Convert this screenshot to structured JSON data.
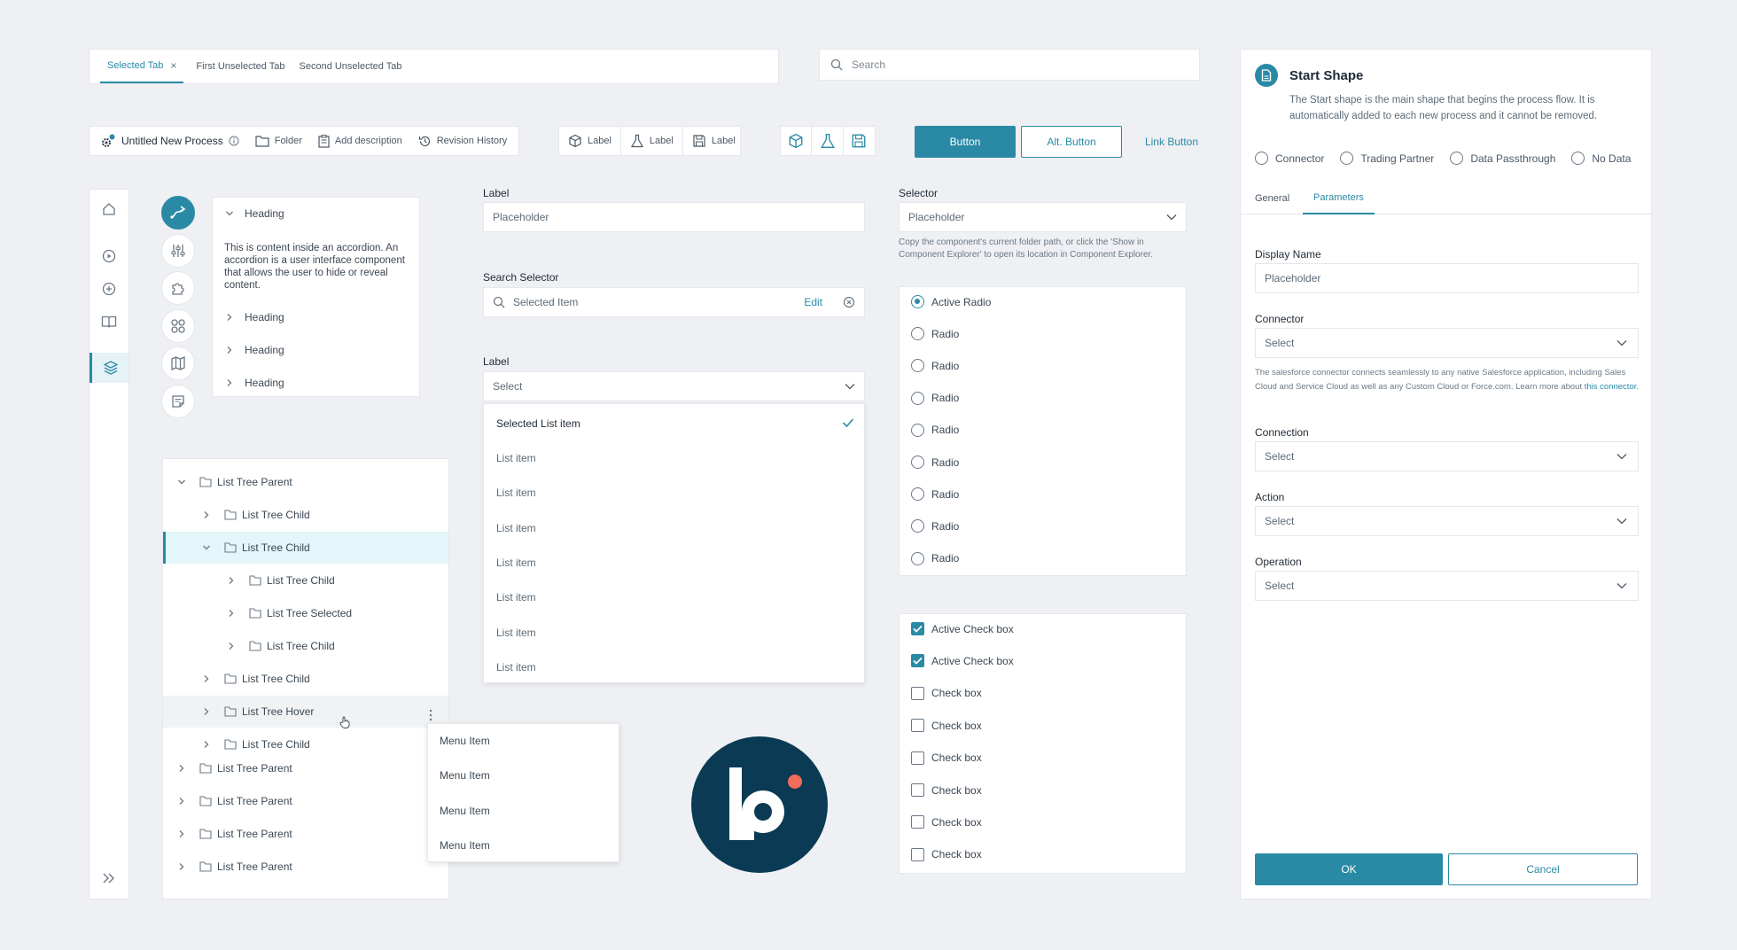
{
  "tabs": {
    "items": [
      {
        "label": "Selected Tab",
        "selected": true
      },
      {
        "label": "First Unselected Tab"
      },
      {
        "label": "Second Unselected Tab"
      }
    ],
    "close": "×"
  },
  "search": {
    "placeholder": "Search",
    "icon": "search-icon"
  },
  "process": {
    "title": "Untitled New Process",
    "folder": "Folder",
    "add_description": "Add description",
    "revision_history": "Revision History"
  },
  "button_group": {
    "labels": [
      "Label",
      "Label",
      "Label"
    ]
  },
  "buttons": {
    "primary": "Button",
    "alt": "Alt. Button",
    "link": "Link Button"
  },
  "accordion": {
    "heading_open": "Heading",
    "content": "This is content inside an accordion. An accordion is a user interface component that allows the user to hide or reveal content.",
    "headings": [
      "Heading",
      "Heading",
      "Heading"
    ]
  },
  "tree": {
    "rows": [
      {
        "label": "List Tree Parent",
        "level": 0,
        "open": true
      },
      {
        "label": "List Tree Child",
        "level": 1
      },
      {
        "label": "List Tree Child",
        "level": 1,
        "open": true,
        "selected": true
      },
      {
        "label": "List Tree Child",
        "level": 2
      },
      {
        "label": "List Tree Selected",
        "level": 2
      },
      {
        "label": "List Tree Child",
        "level": 2
      },
      {
        "label": "List Tree Child",
        "level": 1
      },
      {
        "label": "List Tree Hover",
        "level": 1,
        "hover": true
      },
      {
        "label": "List Tree Child",
        "level": 1
      },
      {
        "label": "List Tree Parent",
        "level": 0
      },
      {
        "label": "List Tree Parent",
        "level": 0
      },
      {
        "label": "List Tree Parent",
        "level": 0
      },
      {
        "label": "List Tree Parent",
        "level": 0
      }
    ]
  },
  "menu": {
    "items": [
      "Menu Item",
      "Menu Item",
      "Menu Item",
      "Menu Item"
    ]
  },
  "form": {
    "label1": "Label",
    "placeholder": "Placeholder",
    "search_selector_label": "Search Selector",
    "search_selector_value": "Selected Item",
    "edit": "Edit",
    "label2": "Label",
    "select_placeholder": "Select",
    "list": {
      "selected": "Selected List item",
      "items": [
        "List item",
        "List item",
        "List item",
        "List item",
        "List item",
        "List item",
        "List item"
      ]
    }
  },
  "selector": {
    "label": "Selector",
    "placeholder": "Placeholder",
    "help": "Copy the component's current folder path, or click the 'Show in Component Explorer' to open its location in Component Explorer."
  },
  "radios": {
    "items": [
      "Active Radio",
      "Radio",
      "Radio",
      "Radio",
      "Radio",
      "Radio",
      "Radio",
      "Radio",
      "Radio"
    ],
    "active_index": 0
  },
  "checks": {
    "items": [
      "Active Check box",
      "Active Check box",
      "Check box",
      "Check box",
      "Check box",
      "Check box",
      "Check box",
      "Check box"
    ],
    "checked": [
      true,
      true,
      false,
      false,
      false,
      false,
      false,
      false
    ]
  },
  "panel": {
    "title": "Start Shape",
    "description": "The Start shape is the main shape that begins the process flow. It is automatically added to each new process and it cannot be removed.",
    "types": [
      "Connector",
      "Trading Partner",
      "Data Passthrough",
      "No Data"
    ],
    "tabs": [
      "General",
      "Parameters"
    ],
    "active_tab": "Parameters",
    "display_name_label": "Display Name",
    "display_name_placeholder": "Placeholder",
    "connector_label": "Connector",
    "connector_select": "Select",
    "connector_help": "The salesforce connector connects seamlessly to any native Salesforce application, including Sales Cloud and Service Cloud as well as any Custom Cloud or Force.com. Learn more about",
    "connector_link": "this connector",
    "connector_help_end": ".",
    "connection_label": "Connection",
    "connection_select": "Select",
    "action_label": "Action",
    "action_select": "Select",
    "operation_label": "Operation",
    "operation_select": "Select",
    "ok": "OK",
    "cancel": "Cancel"
  },
  "colors": {
    "accent": "#2a8aa6",
    "logo_bg": "#0b3a54",
    "logo_dot": "#f26b5b",
    "background": "#eef0f3"
  }
}
